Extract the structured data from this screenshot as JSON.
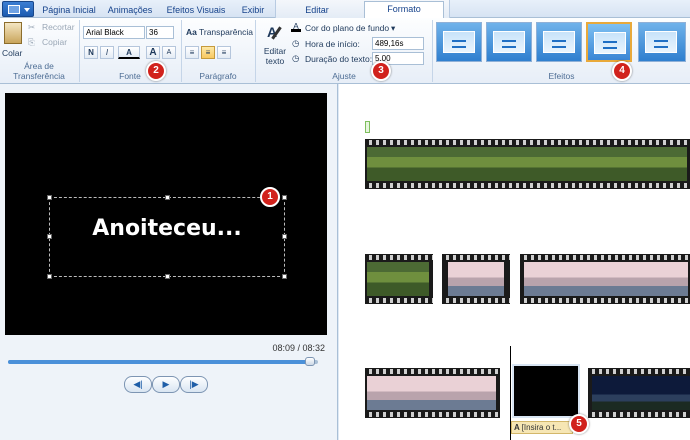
{
  "tabs": {
    "home": "Página Inicial",
    "animations": "Animações",
    "visual_effects": "Efeitos Visuais",
    "view": "Exibir",
    "edit": "Editar",
    "format": "Formato"
  },
  "ribbon": {
    "clipboard": {
      "paste": "Colar",
      "cut": "Recortar",
      "copy": "Copiar",
      "group_label": "Área de Transferência"
    },
    "font": {
      "font_name": "Arial Black",
      "font_size": "36",
      "bold": "N",
      "italic": "I",
      "font_color": "A",
      "grow": "A",
      "shrink": "A",
      "group_label": "Fonte"
    },
    "paragraph": {
      "transparency": "Transparência",
      "group_label": "Parágrafo"
    },
    "adjust": {
      "edit_text_line1": "Editar",
      "edit_text_line2": "texto",
      "background_color": "Cor do plano de fundo",
      "start_time_label": "Hora de início:",
      "start_time_value": "489,16s",
      "duration_label": "Duração do texto:",
      "duration_value": "5,00",
      "group_label": "Ajuste"
    },
    "effects": {
      "group_label": "Efeitos"
    }
  },
  "preview": {
    "overlay_text": "Anoiteceu...",
    "time_display": "08:09 / 08:32",
    "progress": 0.975
  },
  "storyboard": {
    "caption_chip": "[Insira o t..."
  },
  "badges": [
    "1",
    "2",
    "3",
    "4",
    "5"
  ],
  "colors": {
    "accent": "#2f7fcf",
    "badge": "#d1221c",
    "selected_effect_border": "#e9a93a"
  }
}
